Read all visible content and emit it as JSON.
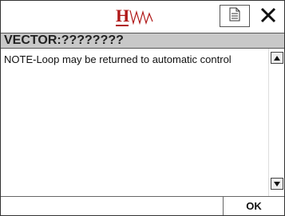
{
  "titlebar": {
    "logo_text": "H",
    "logo_color": "#b01818"
  },
  "header": {
    "title": "VECTOR:????????"
  },
  "message": {
    "text": "NOTE-Loop may be returned to automatic control"
  },
  "footer": {
    "ok_label": "OK"
  },
  "icons": {
    "document": "document-icon",
    "close": "close-icon",
    "scroll_up": "arrow-up-icon",
    "scroll_down": "arrow-down-icon",
    "logo": "h-wave-logo-icon"
  }
}
